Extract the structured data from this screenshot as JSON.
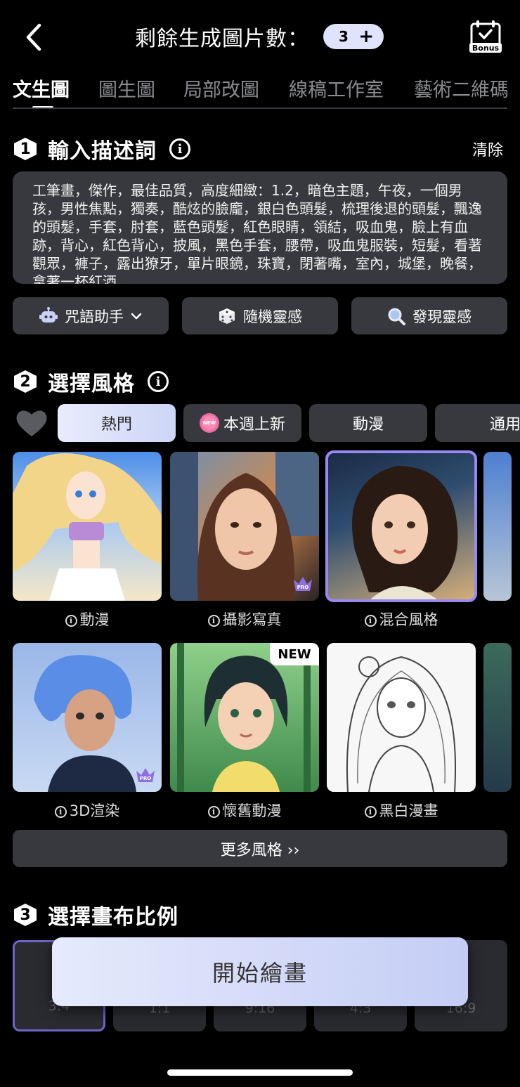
{
  "header": {
    "title": "剩餘生成圖片數：",
    "count": "3",
    "plus": "+",
    "bonus_label": "Bonus"
  },
  "tabs": [
    "文生圖",
    "圖生圖",
    "局部改圖",
    "線稿工作室",
    "藝術二維碼"
  ],
  "section1": {
    "number": "1",
    "title": "輸入描述詞",
    "info": "i",
    "clear_label": "清除",
    "prompt": "工筆畫，傑作，最佳品質，高度細緻：1.2，暗色主題，午夜，一個男孩，男性焦點，獨奏，酷炫的臉龐，銀白色頭髮，梳理後退的頭髮，飄逸的頭髮，手套，肘套，藍色頭髮，紅色眼睛，領結，吸血鬼，臉上有血跡，背心，紅色背心，披風，黑色手套，腰帶，吸血鬼服裝，短髮，看著觀眾，褲子，露出獠牙，單片眼鏡，珠寶，閉著嘴，室內，城堡，晚餐，拿著一杯紅酒",
    "buttons": {
      "spell_helper": "咒語助手",
      "random_inspiration": "隨機靈感",
      "discover_inspiration": "發現靈感"
    }
  },
  "section2": {
    "number": "2",
    "title": "選擇風格",
    "info": "i",
    "chips": [
      "熱門",
      "本週上新",
      "動漫",
      "通用"
    ],
    "new_badge": "NEW",
    "styles": [
      {
        "label": "動漫"
      },
      {
        "label": "攝影寫真",
        "badge": "PRO"
      },
      {
        "label": "混合風格"
      },
      {
        "label": "3D渲染",
        "badge": "PRO"
      },
      {
        "label": "懷舊動漫",
        "tag": "NEW"
      },
      {
        "label": "黑白漫畫"
      }
    ],
    "more_label": "更多風格 ››"
  },
  "section3": {
    "number": "3",
    "title": "選擇畫布比例",
    "ratios": [
      "3:4",
      "1:1",
      "9:16",
      "4:3",
      "16:9"
    ]
  },
  "start_button": "開始繪畫",
  "colors": {
    "background": "#000000",
    "panel": "#38393e",
    "accent": "#dfe3fb",
    "selected_outline": "#9a87f0"
  }
}
